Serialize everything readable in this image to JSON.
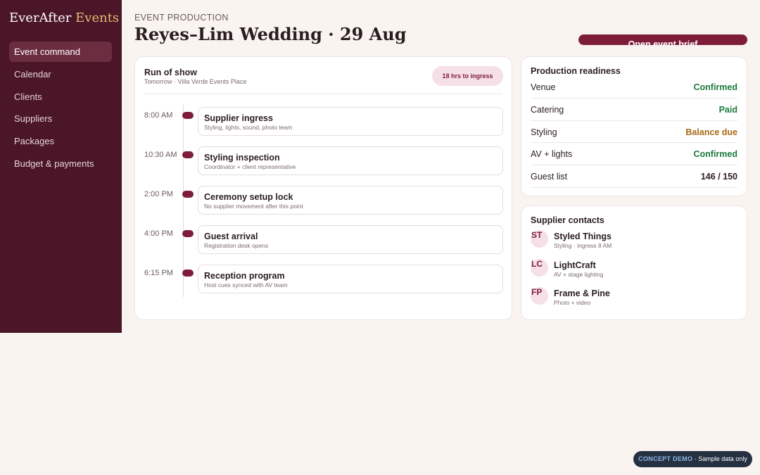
{
  "brand": {
    "name": "EverAfter",
    "accent": "Events"
  },
  "nav": {
    "items": [
      {
        "label": "Event command",
        "active": true
      },
      {
        "label": "Calendar",
        "active": false
      },
      {
        "label": "Clients",
        "active": false
      },
      {
        "label": "Suppliers",
        "active": false
      },
      {
        "label": "Packages",
        "active": false
      },
      {
        "label": "Budget & payments",
        "active": false
      }
    ]
  },
  "header": {
    "eyebrow": "EVENT PRODUCTION",
    "title": "Reyes–Lim Wedding · 29 Aug",
    "brief_button": "Open event brief"
  },
  "run_of_show": {
    "title": "Run of show",
    "subtitle": "Tomorrow · Villa Verde Events Place",
    "badge": "18 hrs to ingress",
    "items": [
      {
        "time": "8:00 AM",
        "title": "Supplier ingress",
        "desc": "Styling, lights, sound, photo team"
      },
      {
        "time": "10:30 AM",
        "title": "Styling inspection",
        "desc": "Coordinator + client representative"
      },
      {
        "time": "2:00 PM",
        "title": "Ceremony setup lock",
        "desc": "No supplier movement after this point"
      },
      {
        "time": "4:00 PM",
        "title": "Guest arrival",
        "desc": "Registration desk opens"
      },
      {
        "time": "6:15 PM",
        "title": "Reception program",
        "desc": "Host cues synced with AV team"
      }
    ]
  },
  "readiness": {
    "title": "Production readiness",
    "rows": [
      {
        "label": "Venue",
        "value": "Confirmed",
        "color": "#1e7a3c"
      },
      {
        "label": "Catering",
        "value": "Paid",
        "color": "#1e7a3c"
      },
      {
        "label": "Styling",
        "value": "Balance due",
        "color": "#a86a12"
      },
      {
        "label": "AV + lights",
        "value": "Confirmed",
        "color": "#1e7a3c"
      },
      {
        "label": "Guest list",
        "value": "146 / 150",
        "color": "#2a1d20"
      }
    ]
  },
  "suppliers": {
    "title": "Supplier contacts",
    "items": [
      {
        "initials": "ST",
        "name": "Styled Things",
        "desc": "Styling · ingress 8 AM"
      },
      {
        "initials": "LC",
        "name": "LightCraft",
        "desc": "AV + stage lighting"
      },
      {
        "initials": "FP",
        "name": "Frame & Pine",
        "desc": "Photo + video"
      }
    ]
  },
  "demo": {
    "strong": "CONCEPT DEMO",
    "rest": " · Sample data only"
  },
  "colors": {
    "sidebar": "#4b1628",
    "accent": "#7d1d3a",
    "gold": "#e8b975"
  }
}
